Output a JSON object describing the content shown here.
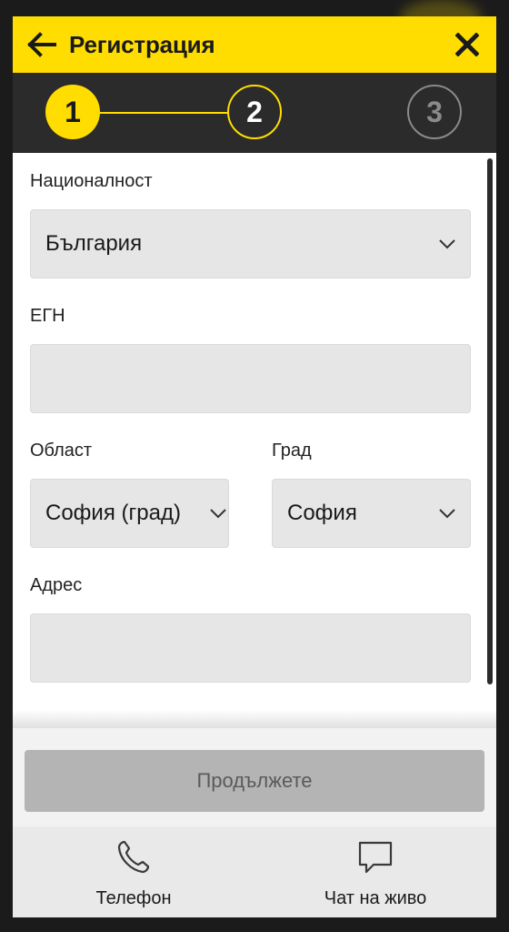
{
  "header": {
    "title": "Регистрация",
    "back_icon": "arrow-left-icon",
    "close_icon": "close-icon",
    "color": "#ffdd00"
  },
  "stepper": {
    "steps": [
      {
        "label": "1",
        "state": "done"
      },
      {
        "label": "2",
        "state": "active"
      },
      {
        "label": "3",
        "state": "todo"
      }
    ]
  },
  "form": {
    "nationality": {
      "label": "Националност",
      "value": "България"
    },
    "egn": {
      "label": "ЕГН",
      "value": ""
    },
    "region": {
      "label": "Област",
      "value": "София (град)"
    },
    "city": {
      "label": "Град",
      "value": "София"
    },
    "address": {
      "label": "Адрес",
      "value": ""
    }
  },
  "cta": {
    "label": "Продължете"
  },
  "footer": {
    "phone": {
      "label": "Телефон",
      "icon": "phone-icon"
    },
    "chat": {
      "label": "Чат на живо",
      "icon": "chat-icon"
    }
  }
}
